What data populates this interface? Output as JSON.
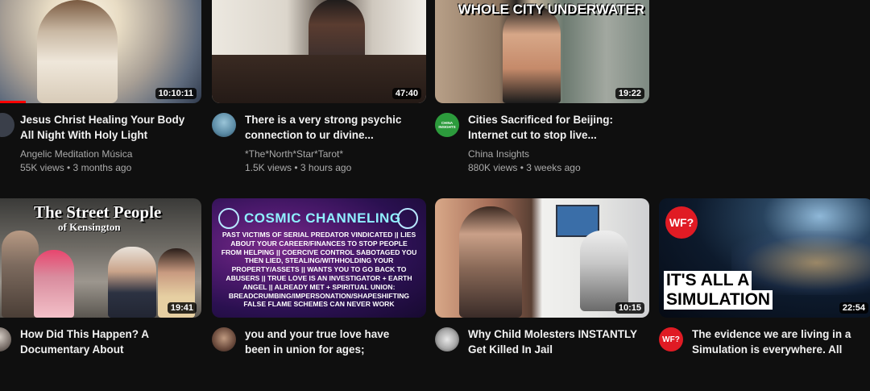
{
  "videos": [
    {
      "title": "Jesus Christ Healing Your Body All Night With Holy Light",
      "channel": "Angelic Meditation Música",
      "stats": "55K views • 3 months ago",
      "duration": "10:10:11",
      "progress": 0.18,
      "avatar_icon": "channel-avatar-icon"
    },
    {
      "title": "There is a very strong psychic connection to ur divine...",
      "channel": "*The*North*Star*Tarot*",
      "stats": "1.5K views • 3 hours ago",
      "duration": "47:40",
      "avatar_icon": "channel-avatar-icon"
    },
    {
      "title": "Cities Sacrificed for Beijing: Internet cut to stop live...",
      "channel": "China Insights",
      "stats": "880K views • 3 weeks ago",
      "duration": "19:22",
      "thumb_caption": "WHOLE CITY UNDERWATER",
      "avatar_text": "CHINA INSIGHTS",
      "avatar_icon": "china-insights-logo-icon"
    },
    {
      "title": "How Did This Happen? A Documentary About Kensington...",
      "duration": "19:41",
      "thumb_caption_1": "The Street People",
      "thumb_caption_2": "of Kensington",
      "avatar_icon": "channel-avatar-icon"
    },
    {
      "title": "you and your true love have been in union for ages; coercive...",
      "thumb_caption_1": "COSMIC CHANNELING",
      "thumb_caption_2": "PAST VICTIMS OF SERIAL PREDATOR VINDICATED || LIES ABOUT YOUR CAREER/FINANCES TO STOP PEOPLE FROM HELPING || COERCIVE CONTROL SABOTAGED YOU THEN LIED, STEALING/WITHHOLDING YOUR PROPERTY/ASSETS || WANTS YOU TO GO BACK TO ABUSERS || TRUE LOVE IS AN INVESTIGATOR + EARTH ANGEL || ALREADY MET + SPIRITUAL UNION: BREADCRUMBING/IMPERSONATION/SHAPESHIFTING FALSE FLAME SCHEMES CAN NEVER WORK",
      "avatar_icon": "channel-avatar-icon"
    },
    {
      "title": "Why Child Molesters INSTANTLY Get Killed In Jail",
      "duration": "10:15",
      "avatar_icon": "channel-avatar-icon"
    },
    {
      "title": "The evidence we are living in a Simulation is everywhere. All yo...",
      "duration": "22:54",
      "thumb_caption_1": "IT'S ALL A",
      "thumb_caption_2": "SIMULATION",
      "thumb_logo": "WF?",
      "avatar_text": "WF?",
      "avatar_icon": "wf-logo-icon",
      "more_label": "⋮"
    }
  ],
  "colors": {
    "background": "#0f0f0f",
    "title": "#f1f1f1",
    "secondary_text": "#aaaaaa",
    "progress": "#ff0000"
  }
}
